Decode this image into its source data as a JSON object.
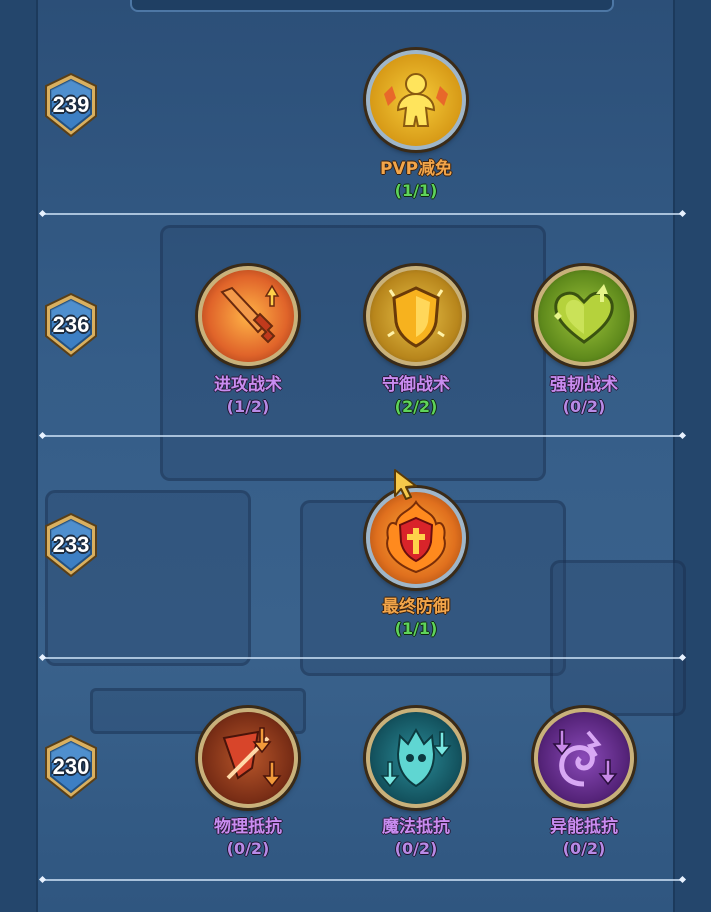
{
  "tiers": [
    {
      "level": "239",
      "skills": [
        {
          "name": "PVP减免",
          "progress": "(1/1)",
          "complete": true,
          "icon": "pvp-reduction-icon"
        }
      ]
    },
    {
      "level": "236",
      "skills": [
        {
          "name": "进攻战术",
          "progress": "(1/2)",
          "complete": false,
          "icon": "sword-attack-icon"
        },
        {
          "name": "守御战术",
          "progress": "(2/2)",
          "complete": true,
          "icon": "shield-defense-icon"
        },
        {
          "name": "强韧战术",
          "progress": "(0/2)",
          "complete": false,
          "icon": "heart-toughness-icon"
        }
      ]
    },
    {
      "level": "233",
      "skills": [
        {
          "name": "最终防御",
          "progress": "(1/1)",
          "complete": true,
          "icon": "flame-shield-icon"
        }
      ]
    },
    {
      "level": "230",
      "skills": [
        {
          "name": "物理抵抗",
          "progress": "(0/2)",
          "complete": false,
          "icon": "physical-resist-icon"
        },
        {
          "name": "魔法抵抗",
          "progress": "(0/2)",
          "complete": false,
          "icon": "magic-resist-icon"
        },
        {
          "name": "异能抵抗",
          "progress": "(0/2)",
          "complete": false,
          "icon": "psionic-resist-icon"
        }
      ]
    }
  ],
  "colors": {
    "locked_name": "#c98cf0",
    "complete_name": "#f2a54a",
    "complete_count": "#5fd45a",
    "badge_blue": "#3d7fc4",
    "badge_gold": "#d9b060"
  }
}
